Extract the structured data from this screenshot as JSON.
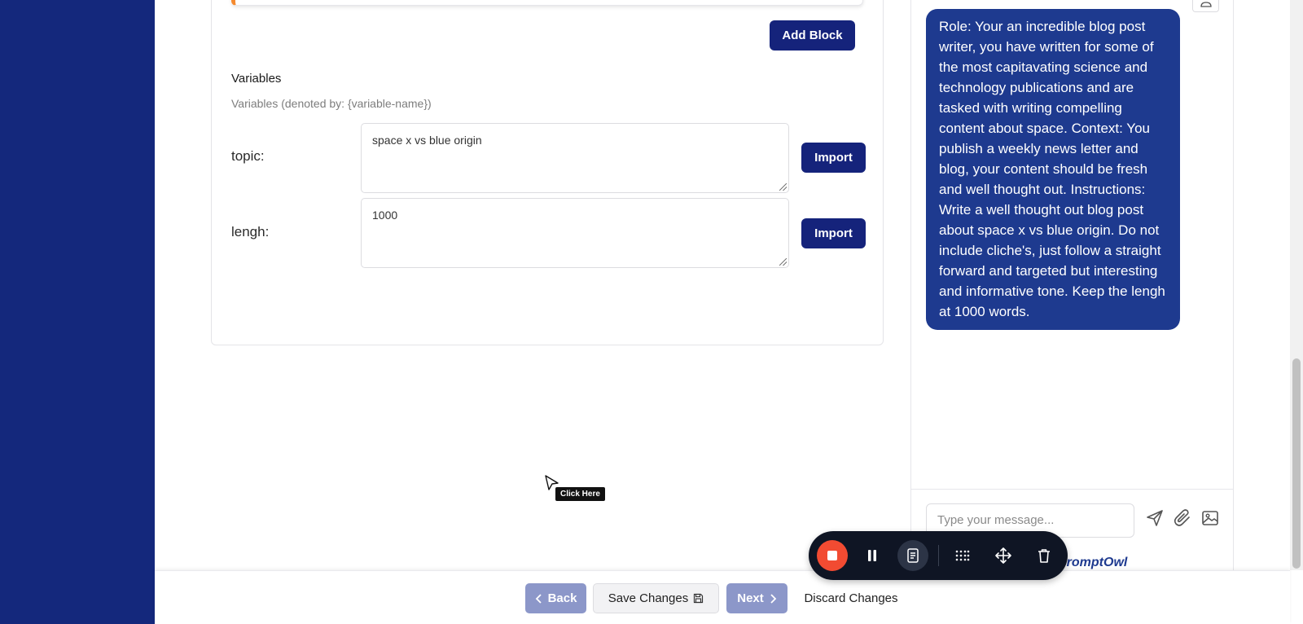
{
  "editor": {
    "add_block_label": "Add Block",
    "variables_title": "Variables",
    "variables_hint": "Variables (denoted by: {variable-name})",
    "variables": [
      {
        "name": "topic:",
        "value": "space x vs blue origin",
        "import_label": "Import"
      },
      {
        "name": "lengh:",
        "value": "1000",
        "import_label": "Import"
      }
    ]
  },
  "overlay": {
    "tooltip": "Click Here"
  },
  "chat": {
    "message": "Role:  Your an incredible blog post writer, you have written for some of the most capitavating science and technology publications and are tasked with writing compelling content about space.  Context: You publish a weekly news letter and blog, your content should be fresh and well thought out.  Instructions:  Write a well thought out blog post about space x vs blue origin.  Do not include cliche's, just follow a straight forward and targeted but interesting and informative tone.  Keep the lengh at 1000 words.",
    "input_placeholder": "Type your message...",
    "brand": "PromptOwl"
  },
  "footer": {
    "back_label": "Back",
    "save_label": "Save Changes",
    "next_label": "Next",
    "discard_label": "Discard Changes"
  },
  "recorder": {
    "buttons": [
      "stop-icon",
      "pause-icon",
      "notes-icon",
      "grid-icon",
      "move-icon",
      "trash-icon"
    ]
  },
  "colors": {
    "sidebar": "#14287c",
    "primary": "#15237b",
    "bubble": "#1e3a8f",
    "accent_orange": "#f58a2e",
    "record_red": "#f24b32"
  }
}
